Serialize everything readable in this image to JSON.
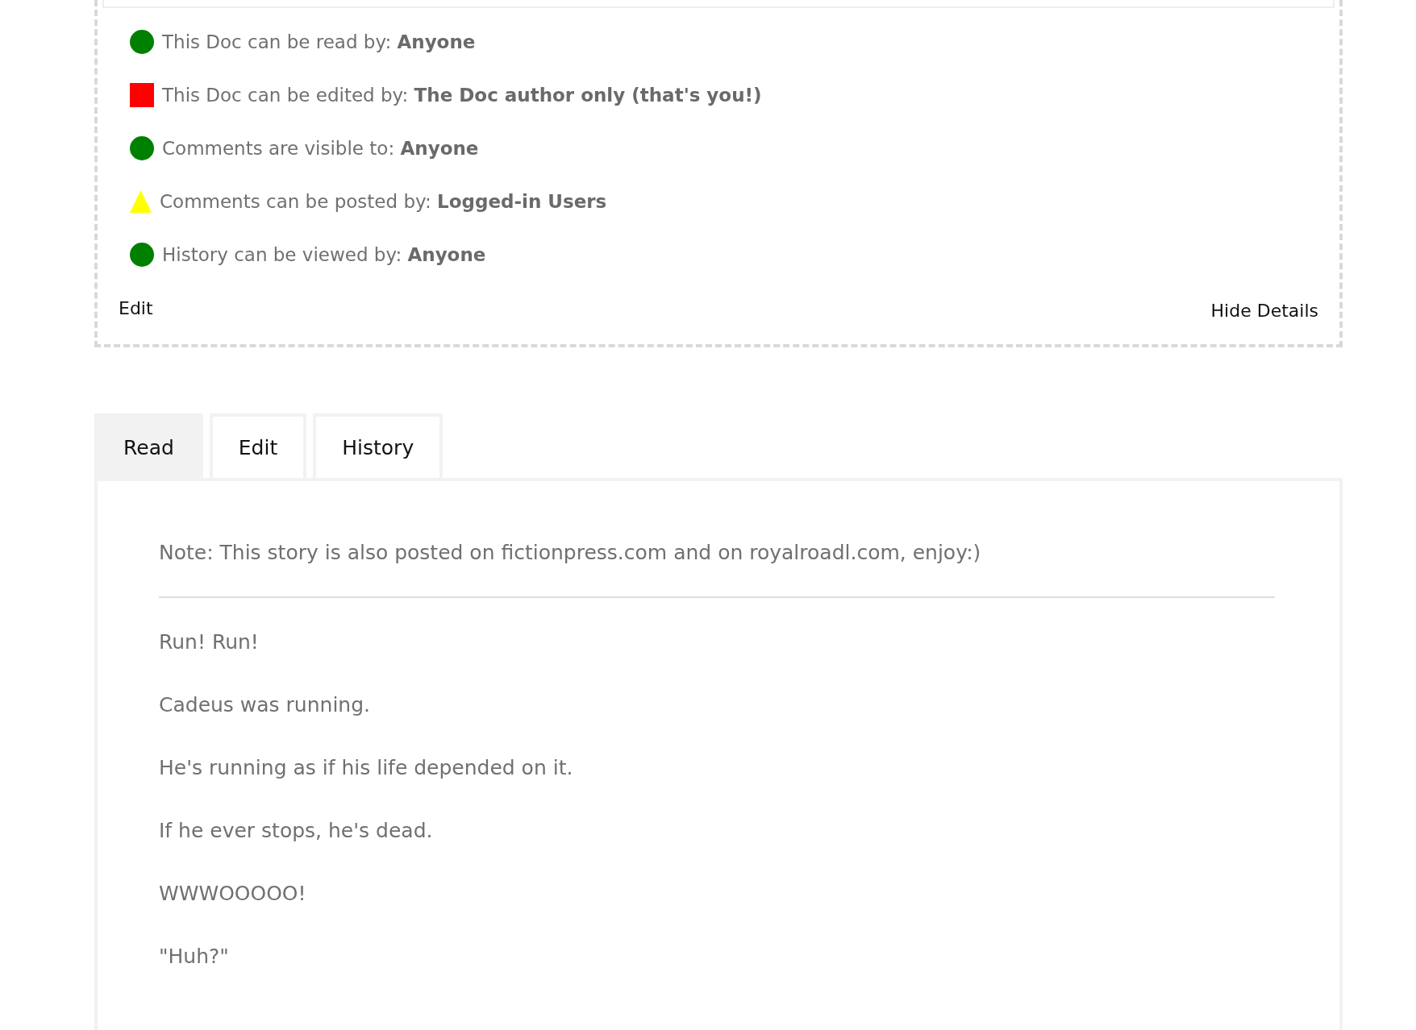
{
  "permissions": [
    {
      "kind": "circle",
      "color": "#008000",
      "text": "This Doc can be read by: **Anyone**"
    },
    {
      "kind": "square",
      "color": "#ff0000",
      "text": "This Doc can be edited by: **The Doc author only (that's you!)**"
    },
    {
      "kind": "circle",
      "color": "#008000",
      "text": "Comments are visible to: **Anyone**"
    },
    {
      "kind": "triangle",
      "color": "#ffff00",
      "text": "Comments can be posted by: **Logged-in Users**"
    },
    {
      "kind": "circle",
      "color": "#008000",
      "text": "History can be viewed by: **Anyone**"
    }
  ],
  "edit_link": "Edit",
  "hide_details_link": "Hide Details",
  "tabs": [
    {
      "label": "Read",
      "selected": true
    },
    {
      "label": "Edit",
      "selected": false
    },
    {
      "label": "History",
      "selected": false
    }
  ],
  "note": "Note: This story is also posted on fictionpress.com and on royalroadl.com, enjoy:)",
  "paragraphs": [
    "Run! Run!",
    "Cadeus was running.",
    "He's running as if his life depended on it.",
    "If he ever stops, he's dead.",
    "WWWOOOOO!",
    "\"Huh?\""
  ]
}
